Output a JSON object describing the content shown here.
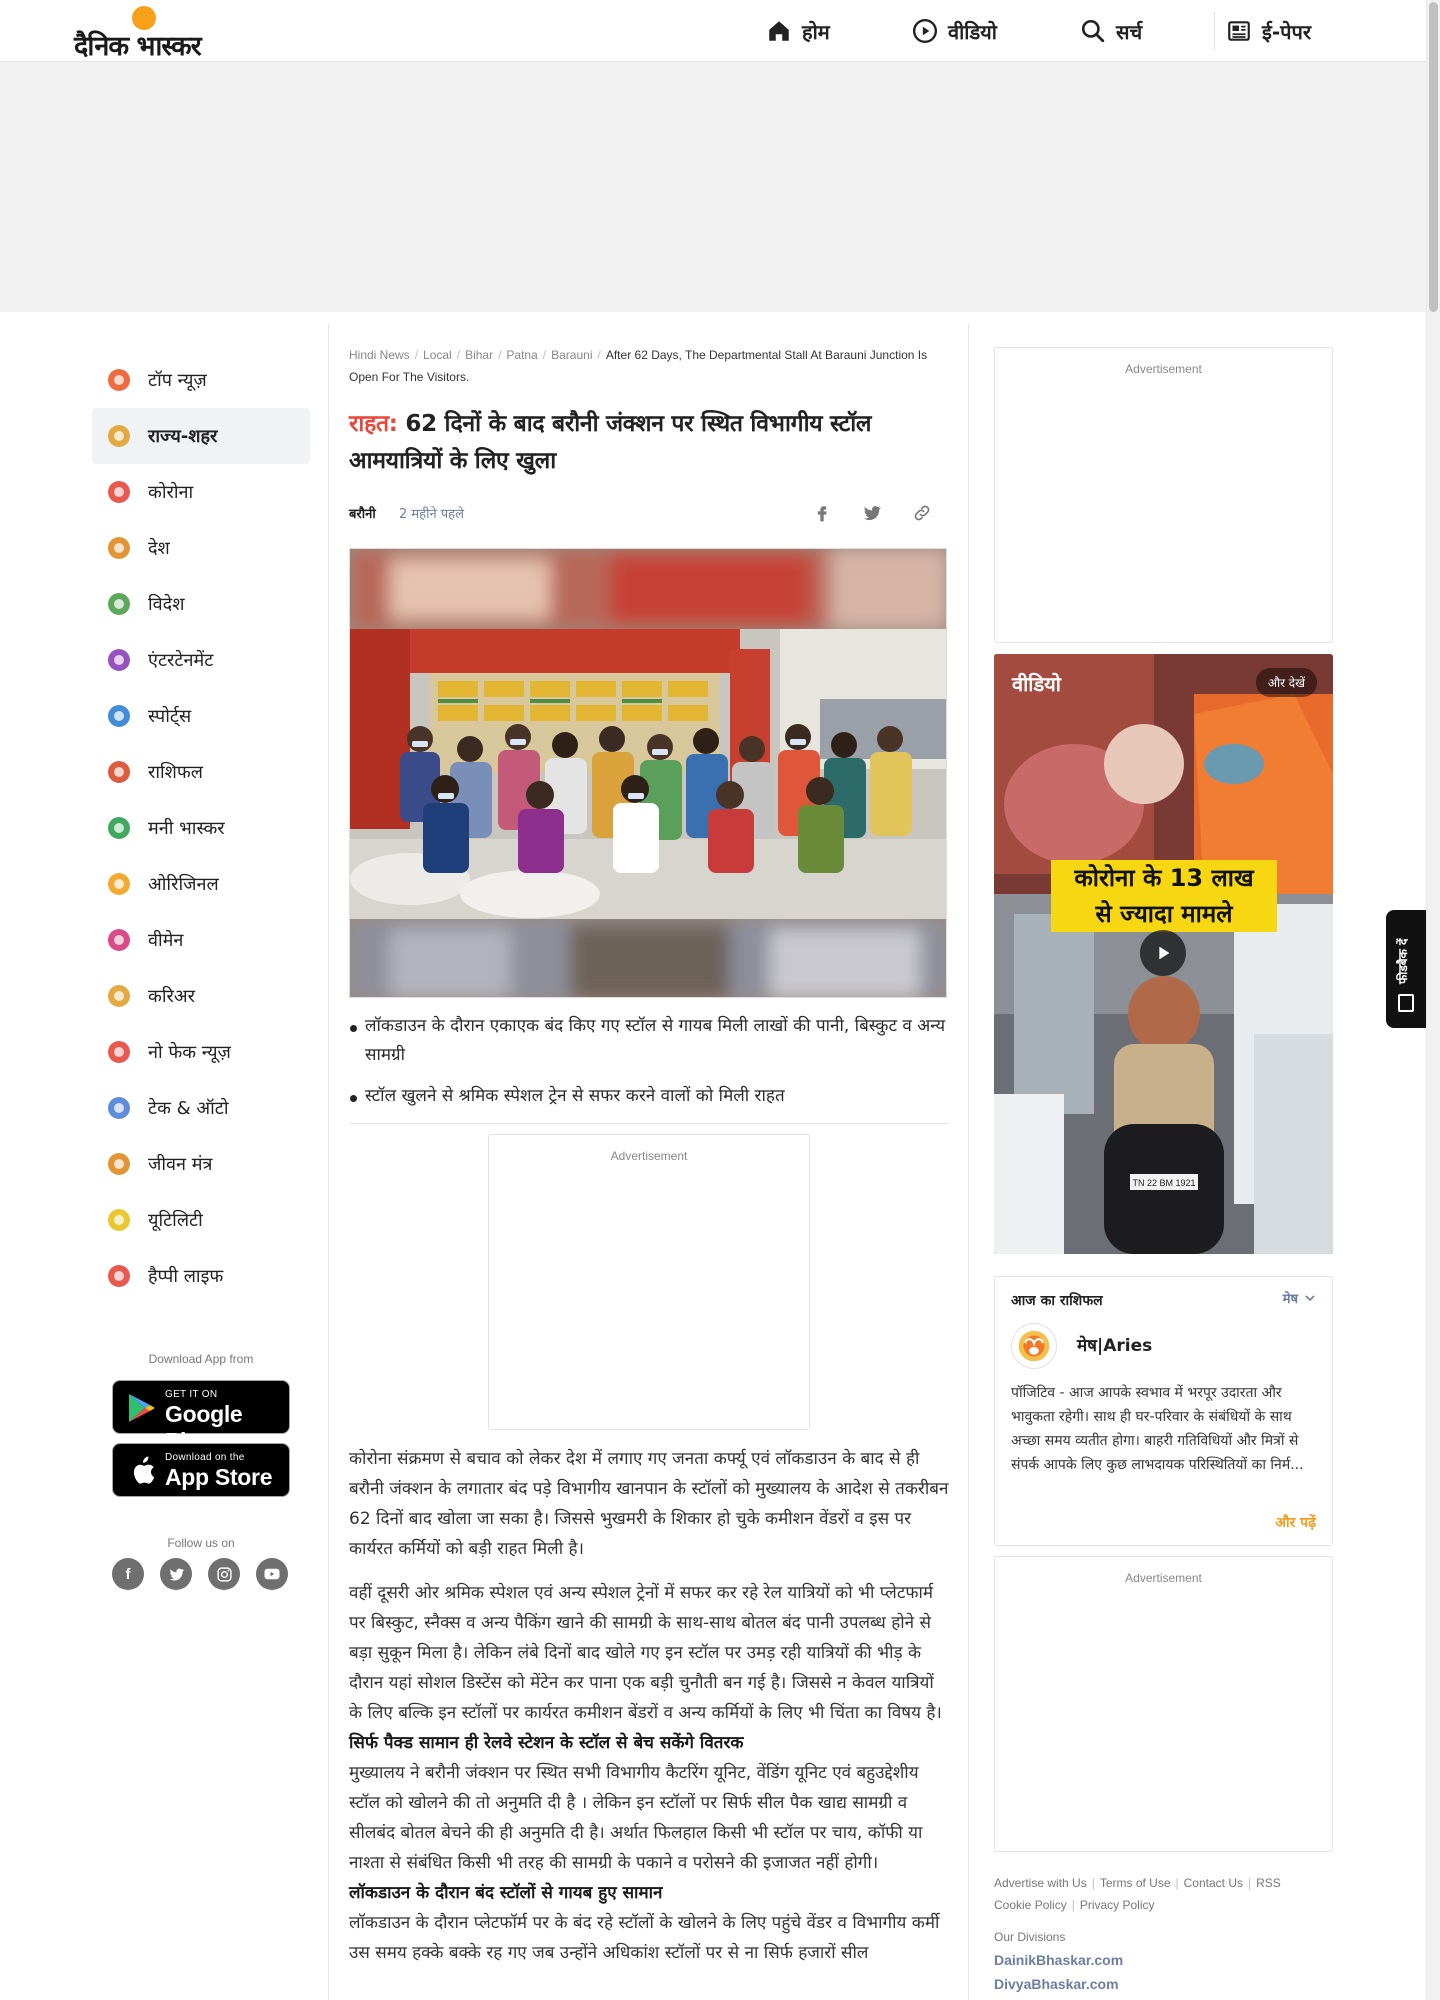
{
  "header": {
    "logo": "दैनिक भास्कर",
    "nav": [
      {
        "label": "होम",
        "icon": "home-icon"
      },
      {
        "label": "वीडियो",
        "icon": "play-circle-icon"
      },
      {
        "label": "सर्च",
        "icon": "search-icon"
      },
      {
        "label": "ई-पेपर",
        "icon": "newspaper-icon"
      }
    ]
  },
  "sidebar": {
    "items": [
      {
        "label": "टॉप न्यूज़",
        "icon": "flame-icon",
        "color": "#f05a28"
      },
      {
        "label": "राज्य-शहर",
        "icon": "city-buildings-icon",
        "color": "#e0a22a",
        "active": true
      },
      {
        "label": "कोरोना",
        "icon": "virus-icon",
        "color": "#e8473b"
      },
      {
        "label": "देश",
        "icon": "india-gate-icon",
        "color": "#e08a1e"
      },
      {
        "label": "विदेश",
        "icon": "globe-icon",
        "color": "#4a9e4a"
      },
      {
        "label": "एंटरटेनमेंट",
        "icon": "clapperboard-icon",
        "color": "#8b3fb8"
      },
      {
        "label": "स्पोर्ट्स",
        "icon": "runner-icon",
        "color": "#2f7fd6"
      },
      {
        "label": "राशिफल",
        "icon": "zodiac-wheel-icon",
        "color": "#d94a2a"
      },
      {
        "label": "मनी भास्कर",
        "icon": "rupee-coin-icon",
        "color": "#2e9e4f"
      },
      {
        "label": "ओरिजिनल",
        "icon": "bhaskar-original-icon",
        "color": "#f2a11d"
      },
      {
        "label": "वीमेन",
        "icon": "women-swirl-icon",
        "color": "#d8357a"
      },
      {
        "label": "करिअर",
        "icon": "graduation-cap-icon",
        "color": "#e0a22a"
      },
      {
        "label": "नो फेक न्यूज़",
        "icon": "no-fake-news-icon",
        "color": "#e8473b"
      },
      {
        "label": "टेक & ऑटो",
        "icon": "tech-auto-icon",
        "color": "#4a7fd6"
      },
      {
        "label": "जीवन मंत्र",
        "icon": "lamp-icon",
        "color": "#e08a1e"
      },
      {
        "label": "यूटिलिटी",
        "icon": "bulb-icon",
        "color": "#e8c21d"
      },
      {
        "label": "हैप्पी लाइफ",
        "icon": "heart-hands-icon",
        "color": "#e8473b"
      }
    ],
    "download_label": "Download App from",
    "google_play": {
      "small": "GET IT ON",
      "big": "Google Play"
    },
    "app_store": {
      "small": "Download on the",
      "big": "App Store"
    },
    "follow_label": "Follow us on"
  },
  "breadcrumb": {
    "items": [
      "Hindi News",
      "Local",
      "Bihar",
      "Patna",
      "Barauni"
    ],
    "current": "After 62 Days, The Departmental Stall At Barauni Junction Is Open For The Visitors."
  },
  "article": {
    "kicker": "राहत:",
    "title": "62 दिनों के बाद बरौनी जंक्शन पर स्थित विभागीय स्टॉल आमयात्रियों के लिए खुला",
    "place": "बरौनी",
    "time": "2 महीने पहले",
    "bullets": [
      "लॉकडाउन के दौरान एकाएक बंद किए गए स्टॉल से गायब मिली लाखों की पानी, बिस्कुट व अन्य सामग्री",
      "स्टॉल खुलने से श्रमिक स्पेशल ट्रेन से सफर करने वालों को मिली राहत"
    ],
    "ad_label": "Advertisement",
    "paragraph_1": "कोरोना संक्रमण से बचाव को लेकर देश में लगाए गए जनता कर्फ्यू एवं लॉकडाउन के बाद से ही बरौनी जंक्शन के लगातार बंद पड़े विभागीय खानपान के स्टॉलों को मुख्यालय के आदेश से तकरीबन 62 दिनों बाद खोला जा सका है। जिससे भुखमरी के शिकार हो चुके कमीशन वेंडरों व इस पर कार्यरत कर्मियों को बड़ी राहत मिली है।",
    "paragraph_2": "वहीं दूसरी ओर श्रमिक स्पेशल एवं अन्य स्पेशल ट्रेनों में सफर कर रहे रेल यात्रियों को भी प्लेटफार्म पर बिस्कुट, स्नैक्स व अन्य पैकिंग खाने की सामग्री के साथ-साथ बोतल बंद पानी उपलब्ध होने से बड़ा सुकून मिला है। लेकिन लंबे दिनों बाद खोले गए इन स्टॉल पर उमड़ रही यात्रियों की भीड़ के दौरान यहां सोशल डिस्टेंस को मेंटेन कर पाना एक बड़ी चुनौती बन गई है। जिससे न केवल यात्रियों के लिए बल्कि इन स्टॉलों पर कार्यरत कमीशन बेंडरों व अन्य कर्मियों के लिए भी चिंता का विषय है।",
    "subhead_1": "सिर्फ पैक्ड सामान ही रेलवे स्टेशन के स्टॉल से बेच सकेंगे वितरक",
    "paragraph_3": "मुख्यालय ने बरौनी जंक्शन पर स्थित सभी विभागीय कैटरिंग यूनिट, वेंडिंग यूनिट एवं बहुउद्देशीय स्टॉल को खोलने की तो अनुमति दी है । लेकिन इन स्टॉलों पर सिर्फ सील पैक खाद्य सामग्री व सीलबंद बोतल बेचने की ही अनुमति दी है। अर्थात फिलहाल किसी भी स्टॉल पर चाय, कॉफी या नाश्ता से संबंधित किसी भी तरह की सामग्री के पकाने व परोसने की इजाजत नहीं होगी।",
    "subhead_2": "लॉकडाउन के दौरान बंद स्टॉलों से गायब हुए सामान",
    "paragraph_4": "लॉकडाउन के दौरान प्लेटफॉर्म पर के बंद रहे स्टॉलों के खोलने के लिए पहुंचे वेंडर व विभागीय कर्मी उस समय हक्के बक्के रह गए जब उन्होंने अधिकांश स्टॉलों  पर से ना सिर्फ हजारों सील"
  },
  "right": {
    "ad_label": "Advertisement",
    "video": {
      "title": "वीडियो",
      "more": "और देखें",
      "caption_line1": "कोरोना के 13 लाख",
      "caption_line2": "से ज्यादा मामले",
      "plate": "TN 22 BM 1921"
    },
    "rashifal": {
      "title": "आज का राशिफल",
      "selected": "मेष",
      "sign": "मेष|Aries",
      "text": "पॉजिटिव - आज आपके स्वभाव में भरपूर उदारता और भावुकता रहेगी। साथ ही घर-परिवार के संबंधियों के साथ अच्छा समय व्यतीत होगा। बाहरी गतिविधियों और मित्रों से संपर्क आपके लिए कुछ लाभदायक परिस्थितियों का निर्म...",
      "more": "और पढ़ें"
    },
    "footer_links": [
      "Advertise with Us",
      "Terms of Use",
      "Contact Us",
      "RSS",
      "Cookie Policy",
      "Privacy Policy"
    ],
    "divisions_label": "Our Divisions",
    "divisions": [
      "DainikBhaskar.com",
      "DivyaBhaskar.com"
    ]
  },
  "feedback": {
    "label": "फीडबैक दें"
  },
  "social": [
    "f",
    "t",
    "ig",
    "yt"
  ],
  "colors": {
    "accent": "#e8473b",
    "link": "#6b7ea3",
    "orange": "#f29b1f"
  }
}
